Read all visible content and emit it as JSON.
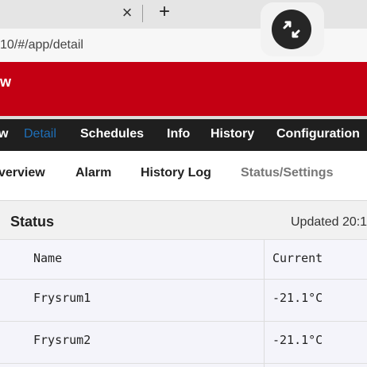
{
  "browser": {
    "tab_close_glyph": "×",
    "new_tab_glyph": "+",
    "url": "10/#/app/detail",
    "remote_icon": "remote-desktop-icon"
  },
  "app": {
    "header_title": "w",
    "header_color": "#c40013"
  },
  "main_nav": {
    "items": [
      "w",
      "Detail",
      "Schedules",
      "Info",
      "History",
      "Configuration"
    ],
    "active": "Detail",
    "active_color": "#1e6fb8"
  },
  "sub_nav": {
    "items": [
      "verview",
      "Alarm",
      "History Log",
      "Status/Settings"
    ]
  },
  "status": {
    "title": "Status",
    "updated": "Updated 20:1",
    "columns": [
      "Name",
      "Current"
    ],
    "rows": [
      {
        "name": "Frysrum1",
        "current": "-21.1°C"
      },
      {
        "name": "Frysrum2",
        "current": "-21.1°C"
      }
    ]
  }
}
